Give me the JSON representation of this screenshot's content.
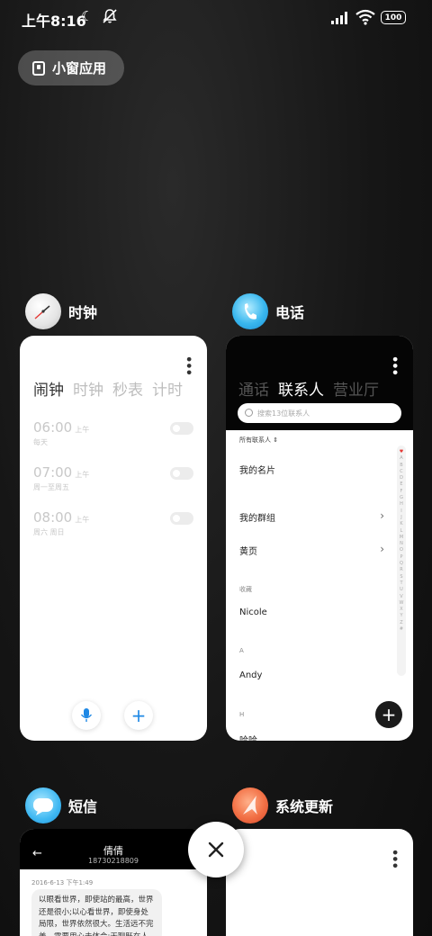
{
  "status_bar": {
    "time": "上午8:16",
    "battery": "100"
  },
  "floating_chip": {
    "label": "小窗应用"
  },
  "apps": {
    "clock": {
      "title": "时钟",
      "tabs": [
        "闹钟",
        "时钟",
        "秒表",
        "计时"
      ],
      "alarms": [
        {
          "time": "06:00",
          "ampm": "上午",
          "repeat": "每天"
        },
        {
          "time": "07:00",
          "ampm": "上午",
          "repeat": "周一至周五"
        },
        {
          "time": "08:00",
          "ampm": "上午",
          "repeat": "周六 周日"
        }
      ]
    },
    "phone": {
      "title": "电话",
      "tabs": [
        "通话",
        "联系人",
        "营业厅"
      ],
      "search_placeholder": "搜索13位联系人",
      "filter": "所有联系人 ⇕",
      "my_card": "我的名片",
      "my_groups": "我的群组",
      "yellow_pages": "黄页",
      "favorites_header": "收藏",
      "favorite_contact": "Nicole",
      "section_a": "A",
      "contact_a": "Andy",
      "section_h": "H",
      "contact_h": "哈哈",
      "alphabet": [
        "♥",
        "A",
        "B",
        "C",
        "D",
        "E",
        "F",
        "G",
        "H",
        "I",
        "J",
        "K",
        "L",
        "M",
        "N",
        "O",
        "P",
        "Q",
        "R",
        "S",
        "T",
        "U",
        "V",
        "W",
        "X",
        "Y",
        "Z",
        "#"
      ]
    },
    "sms": {
      "title": "短信",
      "contact_name": "倩倩",
      "contact_number": "18730218809",
      "date": "2016-6-13 下午1:49",
      "message": "以眼看世界，即使站的最高，世界还是很小;以心看世界，即使身处局限，世界依然很大。生活远不完美，需要用心去体会;无聊既在人"
    },
    "update": {
      "title": "系统更新"
    }
  },
  "colors": {
    "accent_blue": "#1e88e5",
    "background": "#161616"
  }
}
